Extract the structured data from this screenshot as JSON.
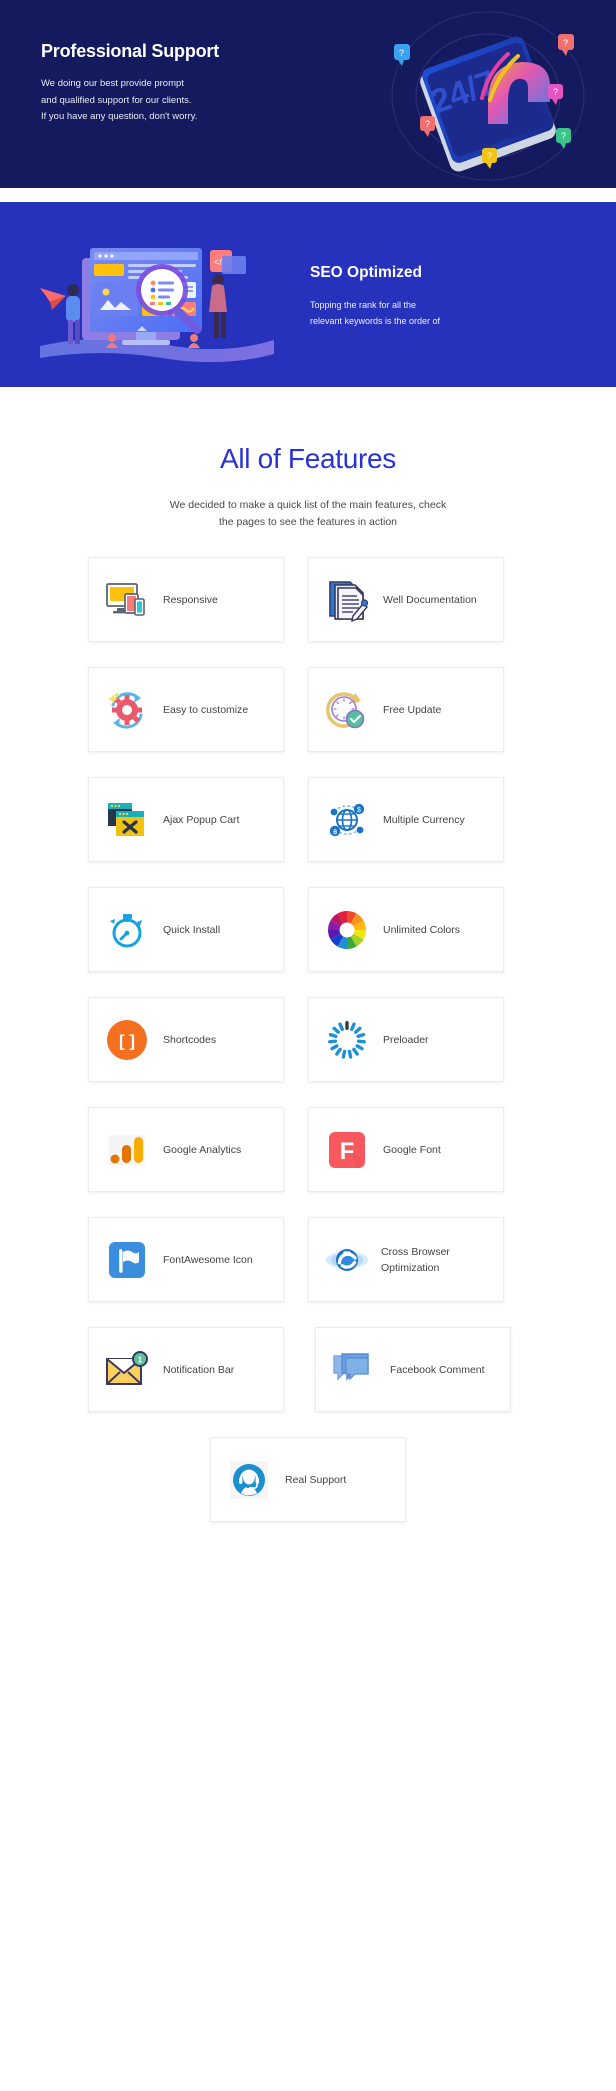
{
  "hero_support": {
    "title": "Professional Support",
    "desc_lines": [
      "We doing our best provide prompt",
      "and qualified support for our clients.",
      "If you have any question, don't worry."
    ],
    "bg_color": "#141A5E",
    "art_label": "24/7"
  },
  "hero_seo": {
    "title": "SEO Optimized",
    "desc_lines": [
      "Topping the rank for all the",
      "relevant keywords is the order of"
    ],
    "bg_color": "#2632BC"
  },
  "features": {
    "heading": "All of Features",
    "heading_color": "#2932D6",
    "subtitle_lines": [
      "We decided to make a quick list of the main features, check",
      "the pages to see the features in action"
    ],
    "items": [
      {
        "label": "Responsive",
        "icon": "responsive-devices-icon"
      },
      {
        "label": "Well Documentation",
        "icon": "documents-pencil-icon"
      },
      {
        "label": "Easy to customize",
        "icon": "gear-refresh-icon"
      },
      {
        "label": "Free Update",
        "icon": "clock-check-icon"
      },
      {
        "label": "Ajax Popup Cart",
        "icon": "popup-window-close-icon"
      },
      {
        "label": "Multiple Currency",
        "icon": "globe-currency-icon"
      },
      {
        "label": "Quick Install",
        "icon": "stopwatch-icon"
      },
      {
        "label": "Unlimited Colors",
        "icon": "color-wheel-icon"
      },
      {
        "label": "Shortcodes",
        "icon": "brackets-circle-icon"
      },
      {
        "label": "Preloader",
        "icon": "spinner-icon"
      },
      {
        "label": "Google Analytics",
        "icon": "analytics-bars-icon"
      },
      {
        "label": "Google Font",
        "icon": "google-font-f-icon"
      },
      {
        "label": "FontAwesome Icon",
        "icon": "flag-square-icon"
      },
      {
        "label": "Cross Browser Optimization",
        "icon": "internet-explorer-icon"
      },
      {
        "label": "Notification Bar",
        "icon": "envelope-badge-icon"
      },
      {
        "label": "Facebook Comment",
        "icon": "speech-bubbles-icon"
      },
      {
        "label": "Real Support",
        "icon": "headset-person-icon"
      }
    ]
  }
}
